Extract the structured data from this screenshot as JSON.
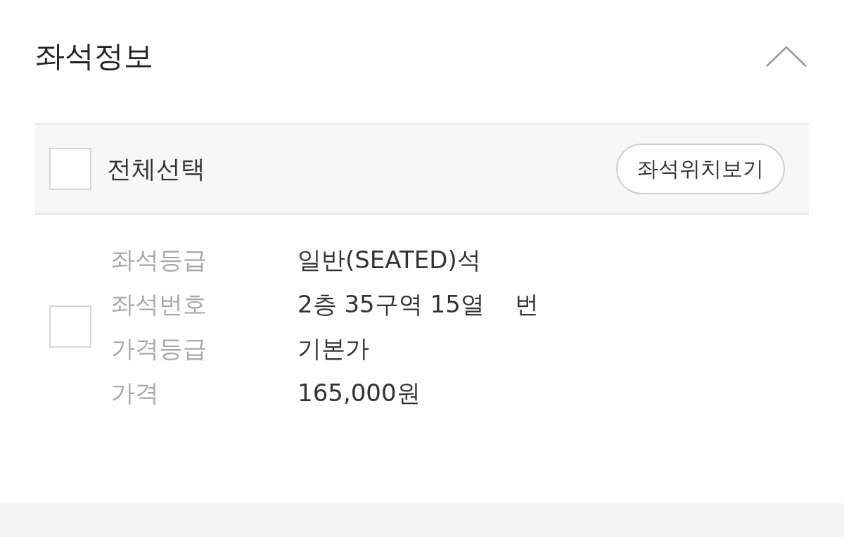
{
  "section": {
    "title": "좌석정보",
    "expanded": true
  },
  "toolbar": {
    "select_all": {
      "label": "전체선택",
      "checked": false
    },
    "seat_map_button": "좌석위치보기"
  },
  "seats": [
    {
      "checked": false,
      "fields": [
        {
          "label": "좌석등급",
          "value": "일반(SEATED)석"
        },
        {
          "label": "좌석번호",
          "value": "2층 35구역 15열    번"
        },
        {
          "label": "가격등급",
          "value": "기본가"
        },
        {
          "label": "가격",
          "value": "165,000원"
        }
      ]
    }
  ]
}
